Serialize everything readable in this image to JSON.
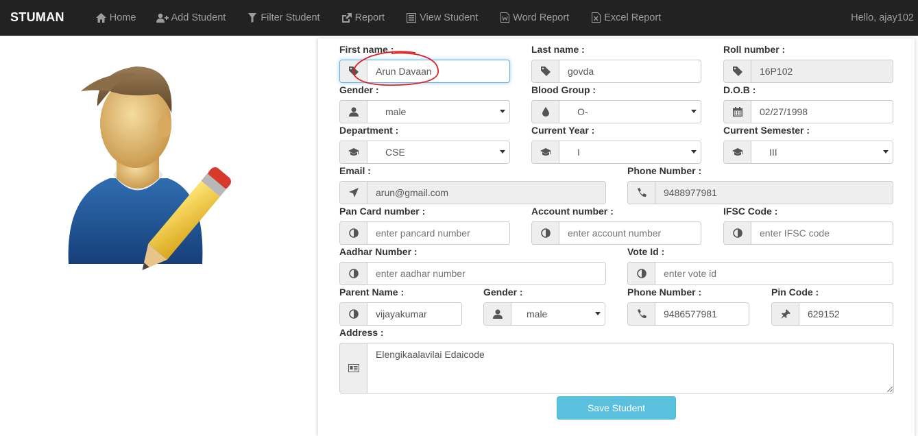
{
  "navbar": {
    "brand": "STUMAN",
    "items": [
      {
        "label": "Home",
        "icon": "home-icon"
      },
      {
        "label": "Add Student",
        "icon": "add-user-icon"
      },
      {
        "label": "Filter Student",
        "icon": "filter-icon"
      },
      {
        "label": "Report",
        "icon": "share-icon"
      },
      {
        "label": "View Student",
        "icon": "list-icon"
      },
      {
        "label": "Word Report",
        "icon": "word-file-icon"
      },
      {
        "label": "Excel Report",
        "icon": "excel-file-icon"
      }
    ],
    "user_greeting": "Hello, ajay102"
  },
  "form": {
    "first_name": {
      "label": "First name :",
      "value": "Arun Davaan"
    },
    "last_name": {
      "label": "Last name :",
      "value": "govda"
    },
    "roll_number": {
      "label": "Roll number :",
      "value": "16P102"
    },
    "gender": {
      "label": "Gender :",
      "value": "male"
    },
    "blood_group": {
      "label": "Blood Group :",
      "value": "O-"
    },
    "dob": {
      "label": "D.O.B :",
      "value": "02/27/1998"
    },
    "department": {
      "label": "Department :",
      "value": "CSE"
    },
    "current_year": {
      "label": "Current Year :",
      "value": "I"
    },
    "current_semester": {
      "label": "Current Semester :",
      "value": "III"
    },
    "email": {
      "label": "Email :",
      "value": "arun@gmail.com"
    },
    "phone_number": {
      "label": "Phone Number :",
      "value": "9488977981"
    },
    "pan_card": {
      "label": "Pan Card number :",
      "placeholder": "enter pancard number"
    },
    "account_number": {
      "label": "Account number :",
      "placeholder": "enter account number"
    },
    "ifsc_code": {
      "label": "IFSC Code :",
      "placeholder": "enter IFSC code"
    },
    "aadhar_number": {
      "label": "Aadhar Number :",
      "placeholder": "enter aadhar number"
    },
    "vote_id": {
      "label": "Vote Id :",
      "placeholder": "enter vote id"
    },
    "parent_name": {
      "label": "Parent Name :",
      "value": "vijayakumar"
    },
    "parent_gender": {
      "label": "Gender :",
      "value": "male"
    },
    "parent_phone": {
      "label": "Phone Number :",
      "value": "9486577981"
    },
    "pin_code": {
      "label": "Pin Code :",
      "value": "629152"
    },
    "address": {
      "label": "Address :",
      "value": "Elengikaalavilai Edaicode"
    },
    "save_label": "Save Student"
  },
  "colors": {
    "navbar_bg": "#222222",
    "accent_button": "#5bc0de",
    "annotation_red": "#e02020"
  }
}
